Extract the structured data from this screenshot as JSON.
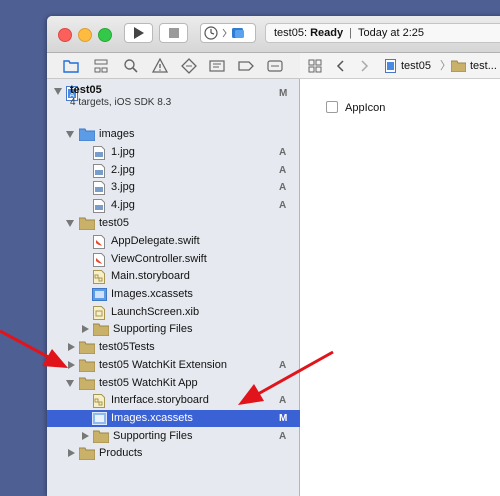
{
  "toolbar": {
    "status_target": "test05:",
    "status_state": "Ready",
    "status_time": "Today at 2:25"
  },
  "icons": {
    "run": "play-icon",
    "stop": "stop-icon",
    "scheme": "scheme-icon",
    "navigator_tabs": [
      "folder-icon",
      "hierarchy-icon",
      "search-icon",
      "warning-icon",
      "test-icon",
      "debug-icon",
      "breakpoint-icon",
      "report-icon"
    ]
  },
  "navigator": {
    "project": {
      "name": "test05",
      "subtitle": "4 targets, iOS SDK 8.3",
      "badge": "M"
    },
    "rows": [
      {
        "label": "images",
        "badge": ""
      },
      {
        "label": "1.jpg",
        "badge": "A"
      },
      {
        "label": "2.jpg",
        "badge": "A"
      },
      {
        "label": "3.jpg",
        "badge": "A"
      },
      {
        "label": "4.jpg",
        "badge": "A"
      },
      {
        "label": "test05",
        "badge": ""
      },
      {
        "label": "AppDelegate.swift",
        "badge": ""
      },
      {
        "label": "ViewController.swift",
        "badge": ""
      },
      {
        "label": "Main.storyboard",
        "badge": ""
      },
      {
        "label": "Images.xcassets",
        "badge": ""
      },
      {
        "label": "LaunchScreen.xib",
        "badge": ""
      },
      {
        "label": "Supporting Files",
        "badge": ""
      },
      {
        "label": "test05Tests",
        "badge": ""
      },
      {
        "label": "test05 WatchKit Extension",
        "badge": "A"
      },
      {
        "label": "test05 WatchKit App",
        "badge": ""
      },
      {
        "label": "Interface.storyboard",
        "badge": "A"
      },
      {
        "label": "Images.xcassets",
        "badge": "M"
      },
      {
        "label": "Supporting Files",
        "badge": "A"
      },
      {
        "label": "Products",
        "badge": ""
      }
    ]
  },
  "editor": {
    "breadcrumb": [
      "test05",
      "test..."
    ],
    "asset_item": "AppIcon"
  },
  "colors": {
    "selection": "#3b62d4",
    "annotation_arrow": "#e0141a",
    "sidebar_bg": "#e6eaf0",
    "desktop": "#4e5f94"
  }
}
